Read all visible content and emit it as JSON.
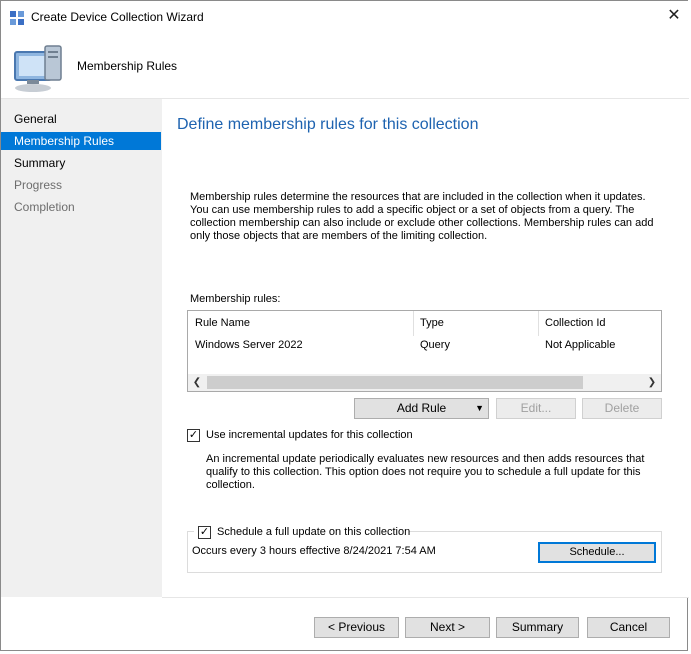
{
  "window": {
    "title": "Create Device Collection Wizard",
    "close_label": "✕",
    "header_title": "Membership Rules"
  },
  "sidebar": {
    "items": [
      {
        "label": "General"
      },
      {
        "label": "Membership Rules"
      },
      {
        "label": "Summary"
      },
      {
        "label": "Progress"
      },
      {
        "label": "Completion"
      }
    ]
  },
  "main": {
    "heading": "Define membership rules for this collection",
    "description": "Membership rules determine the resources that are included in the collection when it updates. You can use membership rules to add a specific object or a set of objects from a query. The collection membership can also include or exclude other collections. Membership rules can add only those objects that are members of the limiting collection.",
    "rules_label": "Membership rules:",
    "columns": [
      "Rule Name",
      "Type",
      "Collection Id"
    ],
    "rows": [
      {
        "name": "Windows Server 2022",
        "type": "Query",
        "collection_id": "Not Applicable"
      }
    ],
    "add_rule_label": "Add Rule",
    "edit_label": "Edit...",
    "delete_label": "Delete",
    "incremental_label": "Use incremental updates for this collection",
    "incremental_checked": true,
    "incremental_desc": "An incremental update periodically evaluates new resources and then adds resources that qualify to this collection. This option does not require you to schedule a full update for this collection.",
    "schedule_label": "Schedule a full update on this collection",
    "schedule_checked": true,
    "schedule_desc": "Occurs every 3 hours effective 8/24/2021 7:54 AM",
    "schedule_button": "Schedule..."
  },
  "footer": {
    "previous": "< Previous",
    "next": "Next >",
    "summary": "Summary",
    "cancel": "Cancel"
  },
  "colors": {
    "accent": "#0078d7",
    "heading": "#1e63b0"
  }
}
